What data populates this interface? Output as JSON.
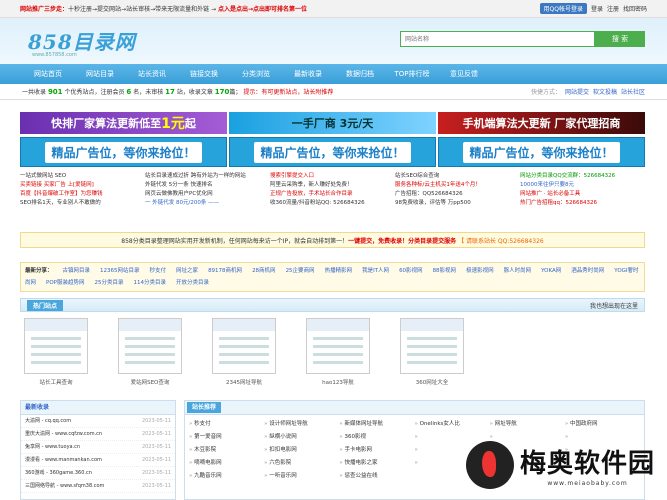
{
  "topbar": {
    "notice_red": "网站推广三步走：",
    "notice_rest": "十秒注册→提交网站→站长审核→带来无限流量和外链 →",
    "notice_red2": "点入是点出→点出即可排名第一位",
    "qq_login": "用QQ帐号登录",
    "login": "登录",
    "register": "注册",
    "forgot": "找回密码"
  },
  "header": {
    "logo": "858目录网",
    "logo_sub": "www.857858.com",
    "search_placeholder": "网站名称",
    "search_button": "搜 索"
  },
  "nav": [
    "网站首页",
    "网站目录",
    "站长资讯",
    "链接交换",
    "分类浏览",
    "最新收录",
    "数据归档",
    "TOP排行榜",
    "意见反馈"
  ],
  "stats": {
    "p1": "一共收录",
    "sites": "901",
    "p2": "个优秀站点，注册会员",
    "members": "6",
    "p3": "名，未审核",
    "pending": "17",
    "p4": "站，收录文章",
    "articles": "170",
    "p5": "篇；",
    "hint": "提示：有可更新站点，站长附推荐",
    "quick_label": "快捷方式：",
    "quick": [
      "网站提交",
      "软文投稿",
      "站长社区"
    ]
  },
  "ads": {
    "a1_pre": "快排厂家算法更新低至",
    "a1_big": "1元",
    "a1_post": "起",
    "a2": "一手厂商 3元/天",
    "a3": "手机端算法大更新 厂家代理招商",
    "spot": "精品广告位，等你来抢位！"
  },
  "links4": [
    [
      "一站式做网站 SEO",
      "买卖链接 买家厂告 上[爱链网]",
      "百度【抖音爆破工作室】为您赚钱",
      "SEO排名1天，专业别人不敢做的"
    ],
    [
      "站长目录速成过折 跨有外站为一样的网站",
      "外链代发 5分一条 快速排名",
      "网页云做佛教用户PC优化网",
      "一 外链代发 80元/200条 ——"
    ],
    [
      "搜索引擎提交入口",
      "阿里云采购季，新人赚好处免费！",
      "正规广告投放，手术站长合作目录",
      "收360流量/抖音粉站QQ: 526684326"
    ],
    [
      "站长SEO综合查询",
      "服务各种标/云主机买1年送4个月！",
      "广告招租：QQ526684326",
      "98免费收录，评估等 万pp500"
    ],
    [
      "网站分类目录QQ交流群：526684326",
      "10000来往伊只要8元",
      "网站推广 · 站长必备工具",
      "热门广告招租qq：526684326"
    ]
  ],
  "notice2": {
    "t1": "858分类目录整理网站实用开发新机制，任何网站每来访一个IP，就会自动排到第一！",
    "t2": "一键提交，免费收录！分类目录提交服务",
    "t3": "【 请联系站长 QQ:526684326"
  },
  "cats": {
    "label": "最新分享：",
    "items": [
      "古镇网目录",
      "12365网站目录",
      "秒支付",
      "网址之家",
      "89178商机网",
      "28商机网",
      "25企要商网",
      "热播精影网",
      "我是IT人网",
      "60影视网",
      "88影视网",
      "极速影视网",
      "豚人时尚网",
      "YOKA网",
      "酒品秀时尚网",
      "YOGI奢时尚网",
      "POP服装趋势网",
      "25分类目录",
      "114分类目录",
      "开放分类目录"
    ]
  },
  "hot": {
    "title": "热门站点",
    "right": "我也想出现在这里"
  },
  "thumbs": [
    "站长工具查询",
    "爱站网SEO查询",
    "2345网址导航",
    "hao123导航",
    "360网址大全"
  ],
  "latest": {
    "title": "最新收录",
    "items": [
      {
        "name": "大渝网 - cq.qq.com",
        "date": "2023-05-11"
      },
      {
        "name": "重庆大渝网 - www.cqfzw.com.cn",
        "date": "2023-05-11"
      },
      {
        "name": "兔享网 - www.tuoya.cn",
        "date": "2023-05-11"
      },
      {
        "name": "漫漫看 - www.manmankan.com",
        "date": "2023-05-11"
      },
      {
        "name": "360游戏 - 360game.360.cn",
        "date": "2023-05-11"
      },
      {
        "name": "三国网络导航 - www.sfqm38.com",
        "date": "2023-05-11"
      }
    ]
  },
  "recommend": {
    "title": "站长推荐",
    "items": [
      "秒支付",
      "设计师网址导航",
      "新媒体网址导航",
      "Onelinks女人比",
      "网址导航",
      "中国政府网",
      "第一爱音网",
      "纵横小说网",
      "360影视",
      "",
      "木豆影院",
      "扣扣电影网",
      "手卡电影网",
      "",
      "嘀嘀电影网",
      "六色影院",
      "快播电影之家",
      "",
      "九酷音乐网",
      "一听音乐网",
      "惩查公益在线",
      ""
    ]
  },
  "watermark": {
    "cn": "梅奥软件园",
    "en": "www.meiaobaby.com"
  }
}
